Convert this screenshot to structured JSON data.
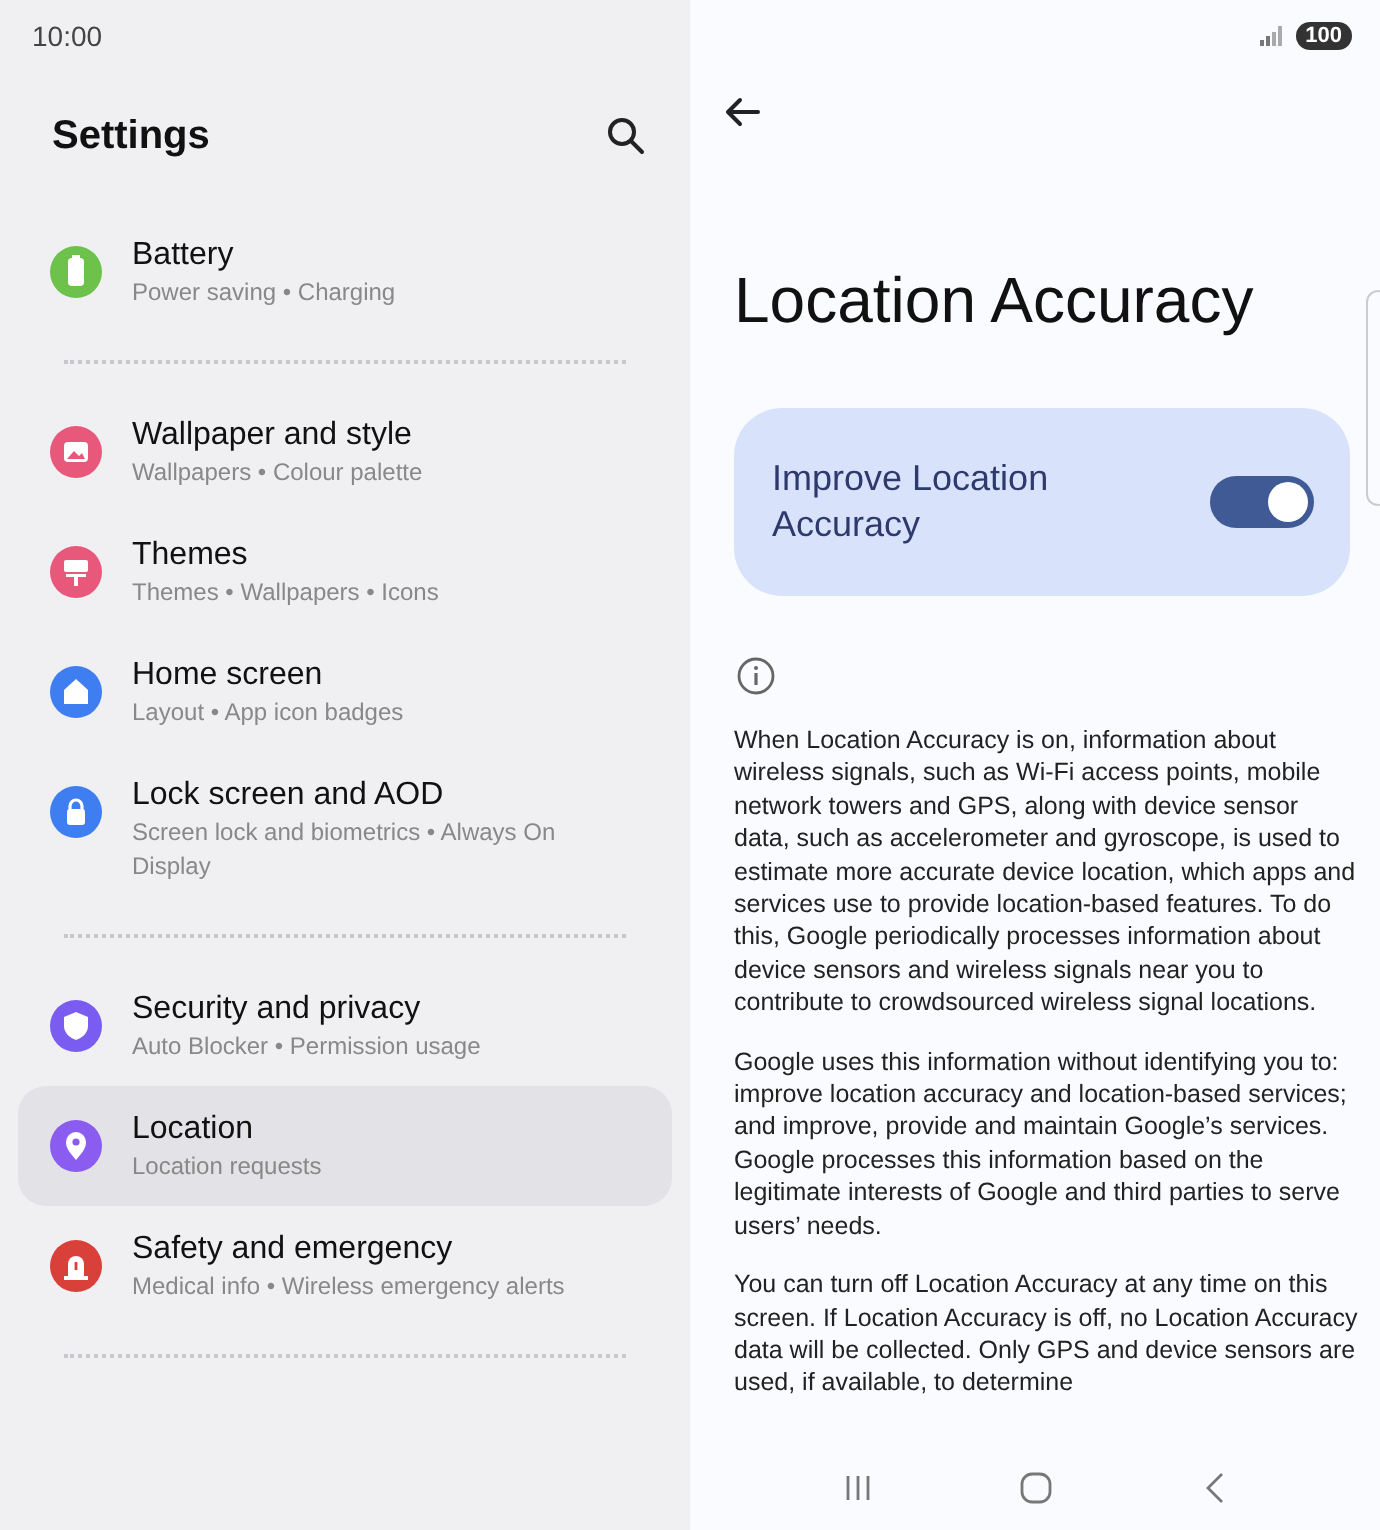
{
  "status_bar": {
    "time": "10:00",
    "battery": "100"
  },
  "settings": {
    "title": "Settings",
    "groups": [
      {
        "items": [
          {
            "title": "Battery",
            "subtitle": "Power saving • Charging",
            "color": "#6cc24a",
            "selected": false
          }
        ]
      },
      {
        "items": [
          {
            "title": "Wallpaper and style",
            "subtitle": "Wallpapers • Colour palette",
            "color": "#e8587a",
            "selected": false
          },
          {
            "title": "Themes",
            "subtitle": "Themes • Wallpapers • Icons",
            "color": "#e8587a",
            "selected": false
          },
          {
            "title": "Home screen",
            "subtitle": "Layout • App icon badges",
            "color": "#3f7ef0",
            "selected": false
          },
          {
            "title": "Lock screen and AOD",
            "subtitle": "Screen lock and biometrics • Always On Display",
            "color": "#3f7ef0",
            "selected": false
          }
        ]
      },
      {
        "items": [
          {
            "title": "Security and privacy",
            "subtitle": "Auto Blocker • Permission usage",
            "color": "#7a5cf0",
            "selected": false
          },
          {
            "title": "Location",
            "subtitle": "Location requests",
            "color": "#8a5cf0",
            "selected": true
          },
          {
            "title": "Safety and emergency",
            "subtitle": "Medical info • Wireless emergency alerts",
            "color": "#d9403a",
            "selected": false
          }
        ]
      }
    ]
  },
  "detail": {
    "title": "Location Accuracy",
    "toggle": {
      "label": "Improve Location Accuracy",
      "on": true
    },
    "paragraphs": [
      "When Location Accuracy is on, information about wireless signals, such as Wi-Fi access points, mobile network towers and GPS, along with device sensor data, such as accelerometer and gyroscope, is used to estimate more accurate device location, which apps and services use to provide location-based features. To do this, Google periodically processes information about device sensors and wireless signals near you to contribute to crowdsourced wireless signal locations.",
      "Google uses this information without identifying you to: improve location accuracy and location-based services; and improve, provide and maintain Google’s services. Google processes this information based on the legitimate interests of Google and third parties to serve users’ needs.",
      "You can turn off Location Accuracy at any time on this screen. If Location Accuracy is off, no Location Accuracy data will be collected. Only GPS and device sensors are used, if available, to determine"
    ]
  }
}
